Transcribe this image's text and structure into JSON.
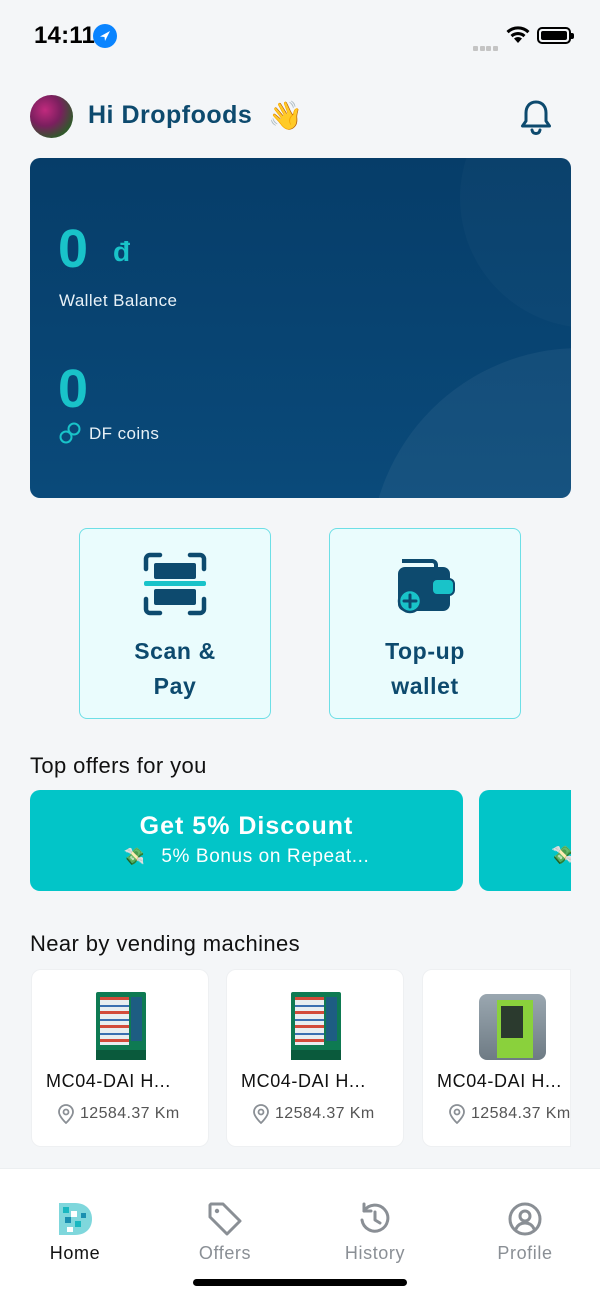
{
  "status_bar": {
    "time": "14:11"
  },
  "header": {
    "greeting": "Hi Dropfoods",
    "wave_emoji": "👋",
    "avatar_icon": "avatar-flowers",
    "bell_icon": "bell-icon"
  },
  "wallet": {
    "balance_value": "0",
    "currency": "đ",
    "balance_label": "Wallet Balance",
    "coins_value": "0",
    "coins_label": "DF coins"
  },
  "actions": {
    "scan_label_line1": "Scan &",
    "scan_label_line2": "Pay",
    "topup_label_line1": "Top-up",
    "topup_label_line2": "wallet"
  },
  "offers": {
    "section_title": "Top offers for you",
    "items": [
      {
        "title": "Get 5% Discount",
        "subtitle": "5% Bonus on Repeat...",
        "emoji": "💸"
      }
    ]
  },
  "machines": {
    "section_title": "Near by vending machines",
    "items": [
      {
        "name": "MC04-DAI H...",
        "distance": "12584.37 Km"
      },
      {
        "name": "MC04-DAI H...",
        "distance": "12584.37 Km"
      },
      {
        "name": "MC04-DAI H...",
        "distance": "12584.37 Km"
      }
    ]
  },
  "bottom_nav": {
    "home": "Home",
    "offers": "Offers",
    "history": "History",
    "profile": "Profile"
  },
  "colors": {
    "accent": "#02c5c8",
    "wallet_bg": "#063d69",
    "primary_text": "#0d4a6e"
  }
}
